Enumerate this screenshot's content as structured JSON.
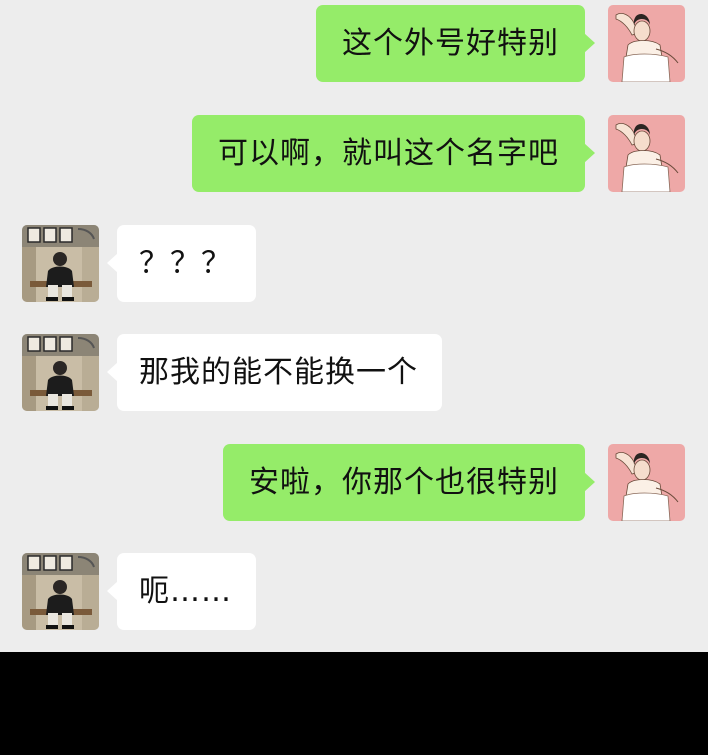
{
  "conversation": {
    "messages": [
      {
        "side": "right",
        "text": "这个外号好特别"
      },
      {
        "side": "right",
        "text": "可以啊，就叫这个名字吧"
      },
      {
        "side": "left",
        "text": "？？？"
      },
      {
        "side": "left",
        "text": "那我的能不能换一个"
      },
      {
        "side": "right",
        "text": "安啦，你那个也很特别"
      },
      {
        "side": "left",
        "text": "呃……"
      }
    ]
  },
  "colors": {
    "chat_background": "#ededed",
    "my_bubble": "#95ec69",
    "their_bubble": "#ffffff",
    "bottom_bar": "#000000"
  },
  "icons": {
    "my_avatar": "woman-illustration-avatar",
    "their_avatar": "man-seated-photo-avatar"
  }
}
